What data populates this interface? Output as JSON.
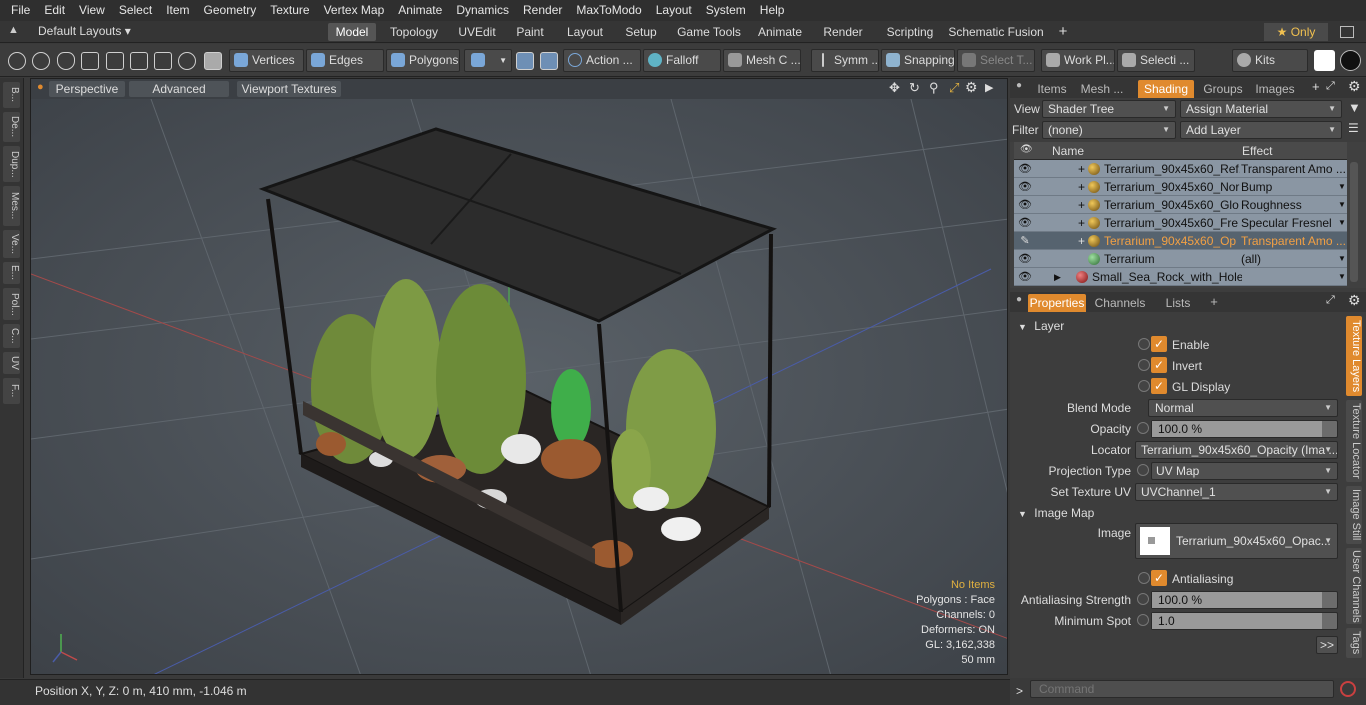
{
  "menu": [
    "File",
    "Edit",
    "View",
    "Select",
    "Item",
    "Geometry",
    "Texture",
    "Vertex Map",
    "Animate",
    "Dynamics",
    "Render",
    "MaxToModo",
    "Layout",
    "System",
    "Help"
  ],
  "layoutbar": {
    "preset": "Default Layouts ▾",
    "tabs": [
      "Model",
      "Topology",
      "UVEdit",
      "Paint",
      "Layout",
      "Setup",
      "Game Tools",
      "Animate",
      "Render",
      "Scripting",
      "Schematic Fusion"
    ],
    "add": "+",
    "only": "★ Only"
  },
  "toolbar": {
    "vertices": "Vertices",
    "edges": "Edges",
    "polygons": "Polygons",
    "action": "Action ...",
    "falloff": "Falloff",
    "mesh": "Mesh C ...",
    "symm": "Symm ...",
    "snapping": "Snapping",
    "select_t": "Select T...",
    "work_pl": "Work Pl...",
    "selecti": "Selecti ...",
    "kits": "Kits"
  },
  "lefttabs": [
    "B...",
    "De...",
    "Dup...",
    "Mes...",
    "Ve...",
    "E...",
    "Pol...",
    "C...",
    "UV",
    "F..."
  ],
  "viewport": {
    "perspective": "Perspective",
    "advanced": "Advanced",
    "viewport_textures": "Viewport Textures",
    "info": {
      "items": "No Items",
      "polygons": "Polygons : Face",
      "channels": "Channels: 0",
      "deformers": "Deformers: ON",
      "gl": "GL: 3,162,338",
      "mm": "50 mm"
    }
  },
  "status": "Position X, Y, Z:   0 m, 410 mm, -1.046 m",
  "panel_tabs": [
    "Items",
    "Mesh ...",
    "Shading",
    "Groups",
    "Images"
  ],
  "shader": {
    "view_label": "View",
    "view_value": "Shader Tree",
    "assign": "Assign Material",
    "filter_label": "Filter",
    "filter_value": "(none)",
    "add_layer": "Add Layer",
    "col_name": "Name",
    "col_effect": "Effect",
    "rows": [
      {
        "name": "Terrarium_90x45x60_Ref...",
        "effect": "Transparent Amo ..."
      },
      {
        "name": "Terrarium_90x45x60_Nor ...",
        "effect": "Bump"
      },
      {
        "name": "Terrarium_90x45x60_Glo ...",
        "effect": "Roughness"
      },
      {
        "name": "Terrarium_90x45x60_Fre ...",
        "effect": "Specular Fresnel"
      },
      {
        "name": "Terrarium_90x45x60_Op ...",
        "effect": "Transparent Amo ..."
      },
      {
        "name": "Terrarium",
        "effect": "(all)"
      },
      {
        "name": "Small_Sea_Rock_with_Holes...",
        "effect": ""
      }
    ]
  },
  "props_tabs": [
    "Properties",
    "Channels",
    "Lists",
    "+"
  ],
  "props": {
    "layer": "Layer",
    "enable": "Enable",
    "invert": "Invert",
    "gl_display": "GL Display",
    "blend_mode_label": "Blend Mode",
    "blend_mode": "Normal",
    "opacity_label": "Opacity",
    "opacity": "100.0 %",
    "locator_label": "Locator",
    "locator": "Terrarium_90x45x60_Opacity (Ima ...",
    "projection_label": "Projection Type",
    "projection": "UV Map",
    "set_uv_label": "Set Texture UV",
    "set_uv": "UVChannel_1",
    "image_map": "Image Map",
    "image_label": "Image",
    "image": "Terrarium_90x45x60_Opac...",
    "antialiasing": "Antialiasing",
    "aa_strength_label": "Antialiasing Strength",
    "aa_strength": "100.0 %",
    "min_spot_label": "Minimum Spot",
    "min_spot": "1.0",
    "more": ">>"
  },
  "sidetabs": [
    "Texture Layers",
    "Texture Locator",
    "Image Still",
    "User Channels",
    "Tags"
  ],
  "command": {
    "prompt": ">",
    "placeholder": "Command"
  }
}
